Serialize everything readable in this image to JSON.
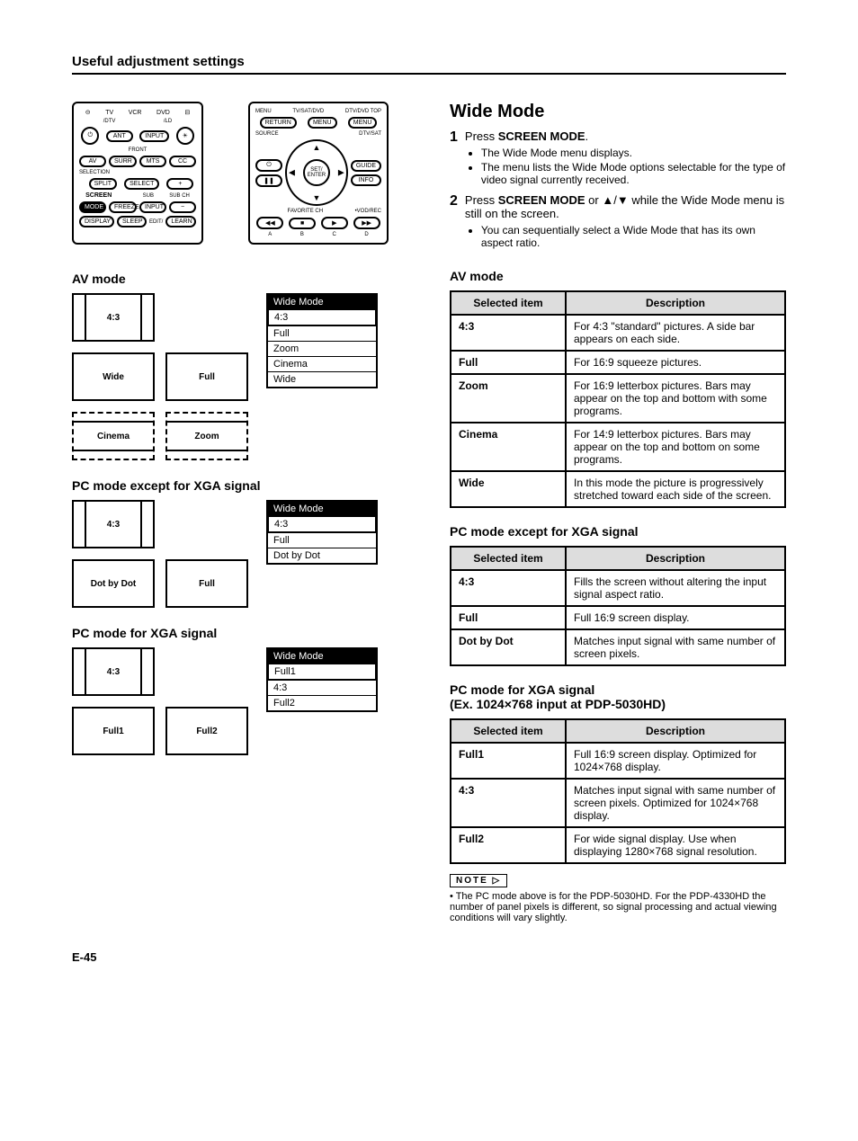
{
  "pageTitle": "Useful adjustment settings",
  "pageNumber": "E-45",
  "remote_left": {
    "labels": {
      "tv": "TV",
      "dtv": "/DTV",
      "vcr": "VCR",
      "dvd": "DVD",
      "ld": "/LD",
      "ant": "ANT",
      "input": "INPUT",
      "front": "FRONT",
      "av": "AV",
      "selection": "SELECTION",
      "surr": "SURR",
      "mts": "MTS",
      "cc": "CC",
      "split": "SPLIT",
      "select": "SELECT",
      "screen": "SCREEN",
      "mode": "MODE",
      "sub": "SUB",
      "subch": "SUB CH",
      "freeze": "FREEZE",
      "plus": "+",
      "minus": "−",
      "display": "DISPLAY",
      "sleep": "SLEEP",
      "edit": "EDIT/",
      "learn": "LEARN"
    }
  },
  "remote_right": {
    "labels": {
      "menu": "MENU",
      "return": "RETURN",
      "tvsatdvd": "TV/SAT/DVD",
      "dtvdvdtop": "DTV/DVD TOP",
      "source": "SOURCE",
      "power": "⏻",
      "dtvsat": "DTV/SAT",
      "guide": "GUIDE",
      "info": "INFO",
      "set_enter": "SET/\nENTER",
      "pause": "❚❚",
      "favorite": "FAVORITE CH",
      "vod": "•VOD/REC",
      "rew": "◀◀",
      "stop": "■",
      "play": "▶",
      "ff": "▶▶",
      "a": "A",
      "b": "B",
      "c": "C",
      "d": "D"
    }
  },
  "left_sections": {
    "av_title": "AV mode",
    "pc_nonxga_title": "PC mode except for XGA signal",
    "pc_xga_title": "PC mode for XGA signal",
    "av_thumbs": [
      "4:3",
      "Wide",
      "Full",
      "Cinema",
      "Zoom"
    ],
    "av_osd": {
      "title": "Wide Mode",
      "items": [
        "4:3",
        "Full",
        "Zoom",
        "Cinema",
        "Wide"
      ],
      "selected": "4:3"
    },
    "pc_nonxga_thumbs": [
      "4:3",
      "Dot by Dot",
      "Full"
    ],
    "pc_nonxga_osd": {
      "title": "Wide Mode",
      "items": [
        "4:3",
        "Full",
        "Dot by Dot"
      ],
      "selected": "4:3"
    },
    "pc_xga_thumbs": [
      "4:3",
      "Full1",
      "Full2"
    ],
    "pc_xga_osd": {
      "title": "Wide Mode",
      "items": [
        "Full1",
        "4:3",
        "Full2"
      ],
      "selected": "Full1"
    }
  },
  "right": {
    "wideModeTitle": "Wide Mode",
    "steps": [
      {
        "num": "1",
        "main_pre": "Press ",
        "main_strong": "SCREEN MODE",
        "main_post": ".",
        "bullets": [
          "The Wide Mode menu displays.",
          "The menu lists the Wide Mode options selectable for the type of video signal currently received."
        ]
      },
      {
        "num": "2",
        "main_pre": "Press ",
        "main_strong": "SCREEN MODE",
        "main_mid": " or ",
        "arrows": "▲/▼",
        "main_post": " while the Wide Mode menu is still on the screen.",
        "bullets": [
          "You can sequentially select a Wide Mode that has its own aspect ratio."
        ]
      }
    ],
    "av_title": "AV mode",
    "av_table": {
      "headers": [
        "Selected item",
        "Description"
      ],
      "rows": [
        [
          "4:3",
          "For 4:3 \"standard\" pictures. A side bar appears on each side."
        ],
        [
          "Full",
          "For 16:9 squeeze pictures."
        ],
        [
          "Zoom",
          "For 16:9 letterbox pictures. Bars may appear on the top and bottom with some programs."
        ],
        [
          "Cinema",
          "For 14:9 letterbox pictures. Bars may appear on the top and bottom on some programs."
        ],
        [
          "Wide",
          "In this mode the picture is progressively stretched toward each side of the screen."
        ]
      ]
    },
    "pc_nonxga_title": "PC mode except for XGA signal",
    "pc_nonxga_table": {
      "headers": [
        "Selected item",
        "Description"
      ],
      "rows": [
        [
          "4:3",
          "Fills the screen without altering the input signal aspect ratio."
        ],
        [
          "Full",
          "Full 16:9 screen display."
        ],
        [
          "Dot by Dot",
          "Matches input signal with same number of screen pixels."
        ]
      ]
    },
    "pc_xga_title": "PC mode for XGA signal",
    "pc_xga_subtitle": "(Ex. 1024×768 input at PDP-5030HD)",
    "pc_xga_table": {
      "headers": [
        "Selected item",
        "Description"
      ],
      "rows": [
        [
          "Full1",
          "Full 16:9 screen display.\nOptimized for 1024×768 display."
        ],
        [
          "4:3",
          "Matches input signal with same number of screen pixels.\nOptimized for 1024×768 display."
        ],
        [
          "Full2",
          "For wide signal display.\nUse when displaying 1280×768 signal resolution."
        ]
      ]
    },
    "note_label": "NOTE",
    "note_text": "• The PC mode above is for the PDP-5030HD. For the PDP-4330HD the number of panel pixels is different, so signal processing and actual viewing conditions will vary slightly."
  }
}
